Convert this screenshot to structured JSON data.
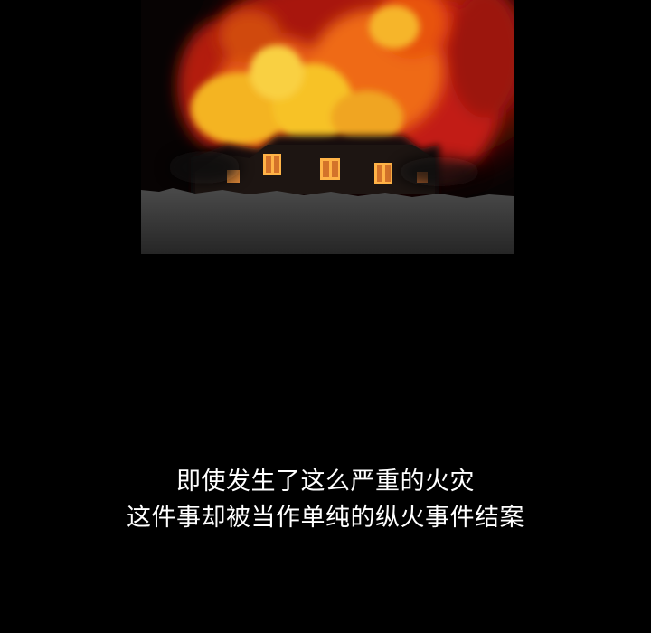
{
  "scene": {
    "subject": "burning-house",
    "colors": {
      "background": "#000000",
      "flame_red": "#c81e10",
      "flame_orange": "#f06a12",
      "flame_yellow": "#f7c227",
      "ground": "#3a3a3a",
      "window_glow": "#ffb347"
    }
  },
  "caption": {
    "line1": "即使发生了这么严重的火灾",
    "line2": "这件事却被当作单纯的纵火事件结案"
  }
}
